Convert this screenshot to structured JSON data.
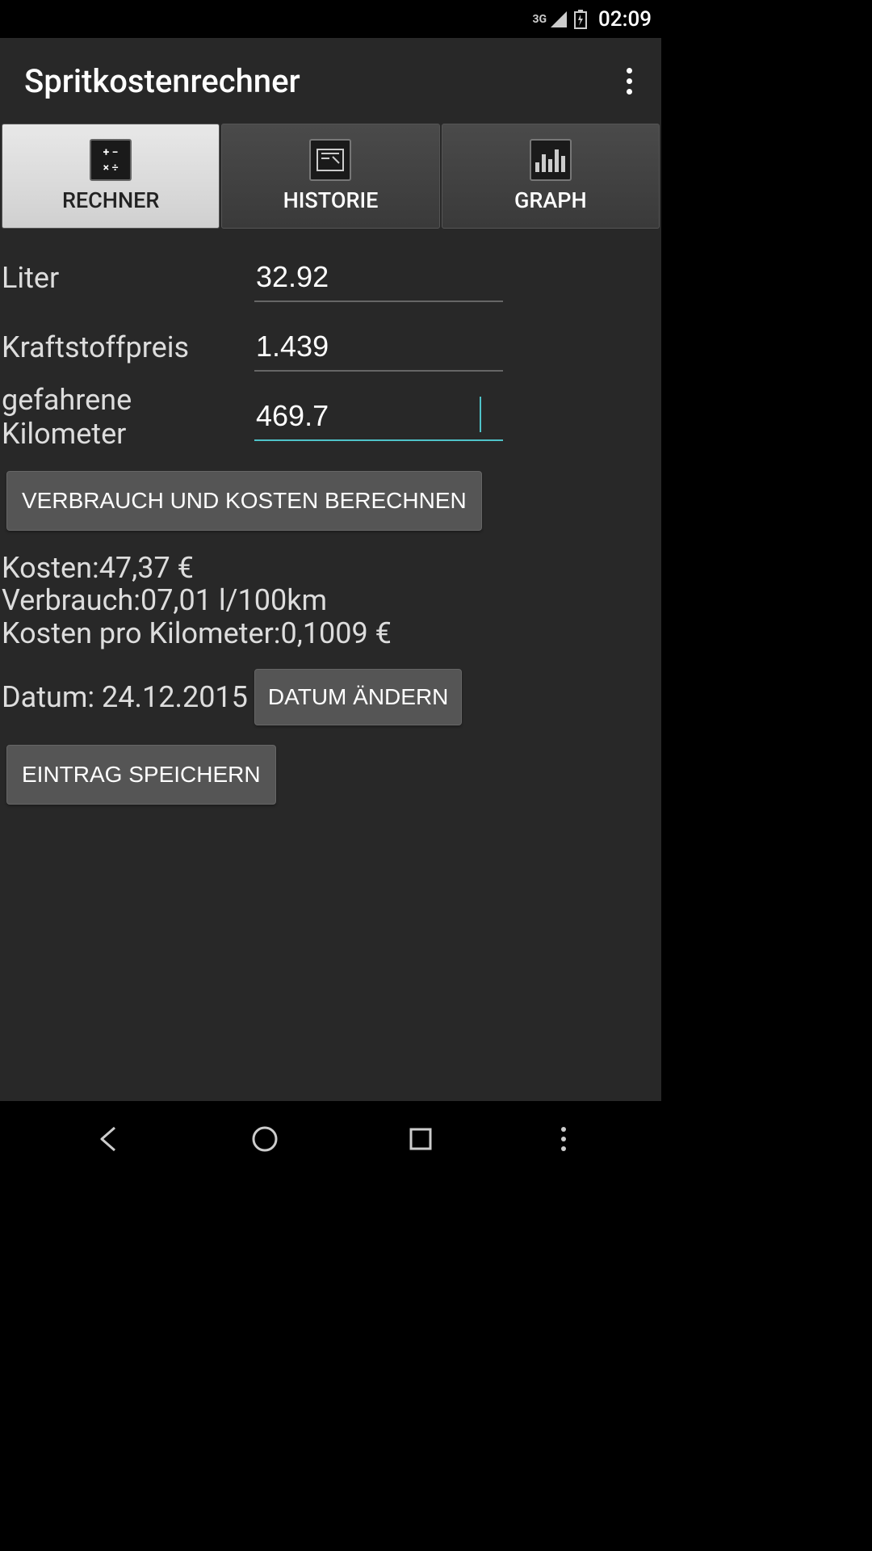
{
  "status_bar": {
    "network": "3G",
    "time": "02:09"
  },
  "app_bar": {
    "title": "Spritkostenrechner"
  },
  "tabs": [
    {
      "label": "RECHNER",
      "icon": "calculator-icon",
      "active": true
    },
    {
      "label": "HISTORIE",
      "icon": "history-icon",
      "active": false
    },
    {
      "label": "GRAPH",
      "icon": "chart-icon",
      "active": false
    }
  ],
  "form": {
    "liter": {
      "label": "Liter",
      "value": "32.92"
    },
    "price": {
      "label": "Kraftstoffpreis",
      "value": "1.439"
    },
    "km": {
      "label": "gefahrene Kilometer",
      "value": "469.7"
    }
  },
  "buttons": {
    "calculate": "VERBRAUCH UND KOSTEN BERECHNEN",
    "change_date": "DATUM ÄNDERN",
    "save": "EINTRAG SPEICHERN"
  },
  "results": {
    "cost": "Kosten:47,37 €",
    "consumption": "Verbrauch:07,01 l/100km",
    "cost_per_km": "Kosten pro Kilometer:0,1009 €"
  },
  "date": {
    "label": "Datum: 24.12.2015"
  }
}
